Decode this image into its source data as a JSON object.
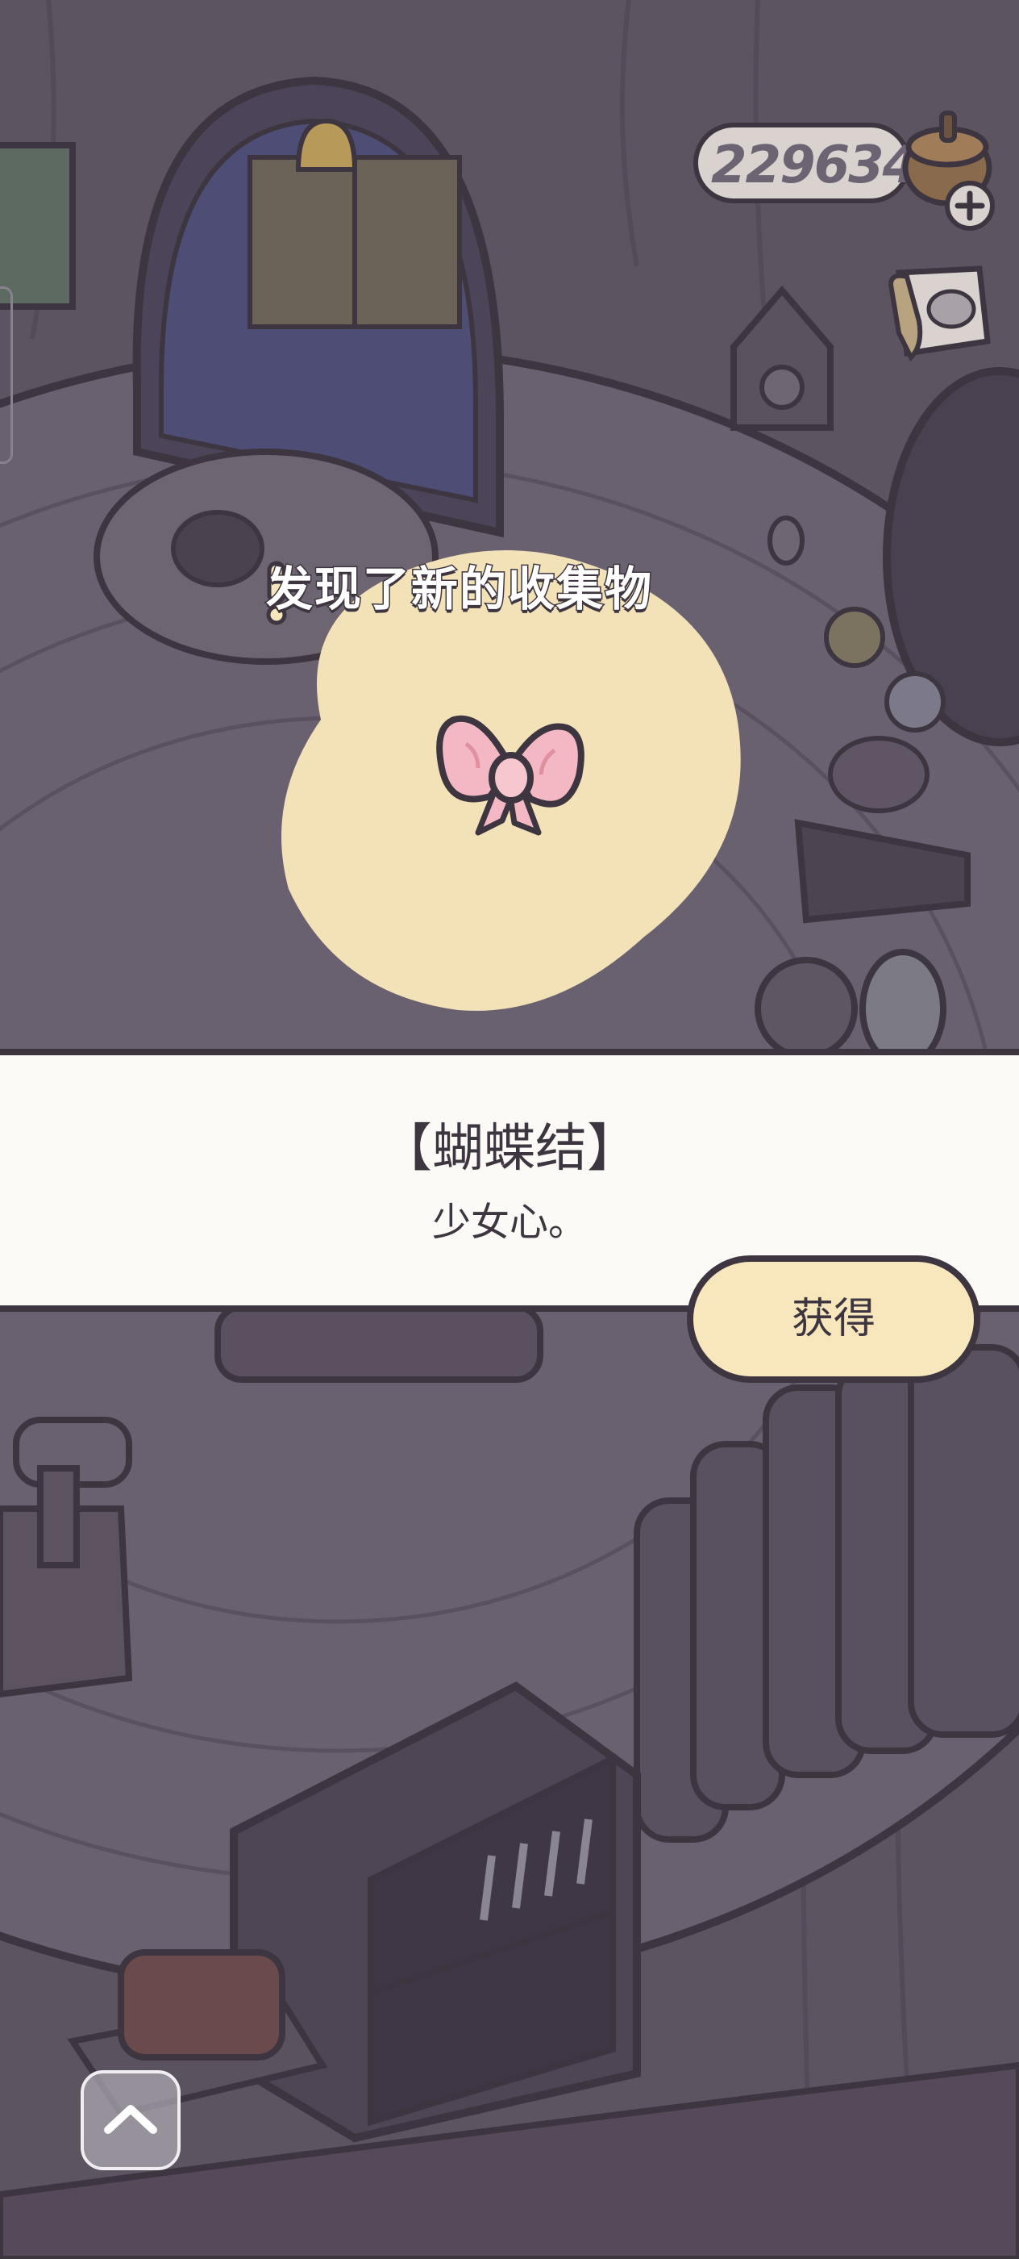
{
  "hud": {
    "currency_icon": "clover-acorn-icon",
    "currency_value": "229634",
    "add_icon": "plus-icon",
    "album_icon": "album-icon"
  },
  "discovery": {
    "title": "发现了新的收集物",
    "exclaim_icon": "exclamation-icon",
    "item_icon": "pink-bow-icon"
  },
  "item": {
    "name": "【蝴蝶结】",
    "description": "少女心。"
  },
  "actions": {
    "get_label": "获得",
    "scroll_up_icon": "chevron-up-icon"
  },
  "colors": {
    "outline": "#3d353f",
    "cream": "#f8e7bc",
    "panel": "#fcfaf6",
    "dim_background": "#5c5360",
    "bow_pink": "#f4b8c4"
  }
}
